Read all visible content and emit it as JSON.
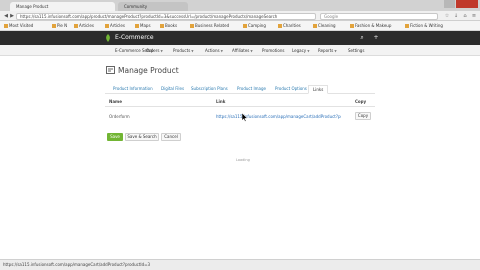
{
  "browser": {
    "tabs": [
      {
        "label": "Manage Product",
        "active": true
      },
      {
        "label": "Community",
        "active": false
      }
    ],
    "url": "https://sa115.infusionsoft.com/app/product/manageProduct?productId=3&successUrl=/product/manageProducts/manageSearch",
    "search_placeholder": "Google",
    "bookmarks": [
      "Most Visited",
      "Pie N",
      "Articles",
      "Articles",
      "Maps",
      "Books",
      "Business Related",
      "Camping",
      "Charities",
      "Cleaning",
      "Fashion & Makeup",
      "Fiction & Writing"
    ]
  },
  "app": {
    "title": "E-Commerce",
    "menu": [
      {
        "label": "E-Commerce Setup",
        "caret": false
      },
      {
        "label": "Orders",
        "caret": true
      },
      {
        "label": "Products",
        "caret": true
      },
      {
        "label": "Actions",
        "caret": true
      },
      {
        "label": "Affiliates",
        "caret": true
      },
      {
        "label": "Promotions",
        "caret": false
      },
      {
        "label": "Legacy",
        "caret": true
      },
      {
        "label": "Reports",
        "caret": true
      },
      {
        "label": "Settings",
        "caret": false
      }
    ],
    "accent": "#72b534"
  },
  "page": {
    "title": "Manage Product",
    "tabs": [
      "Product Information",
      "Digital Files",
      "Subscription Plans",
      "Product Image",
      "Product Options",
      "Links"
    ],
    "active_tab": "Links",
    "table": {
      "headers": [
        "Name",
        "Link",
        "Copy"
      ],
      "row": {
        "name": "Orderform",
        "link": "https://sa115.infusionsoft.com/app/manageCart/addProduct?productId=3",
        "copy_label": "Copy"
      }
    },
    "buttons": {
      "save": "Save",
      "save_search": "Save & Search",
      "cancel": "Cancel"
    },
    "footer": "Loading"
  },
  "status": {
    "text": "https://sa115.infusionsoft.com/app/manageCart/addProduct?productId=3"
  }
}
